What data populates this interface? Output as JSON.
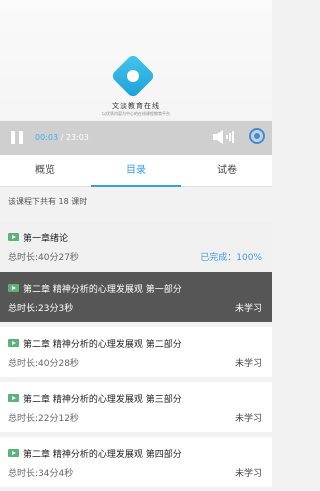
{
  "player": {
    "brand_name": "文淡教育在线",
    "brand_subtitle": "以优质内容为中心的在线课程教育平台",
    "time_current": "00:03",
    "time_separator": " / ",
    "time_total": "23:03",
    "icons": [
      "pause-icon",
      "volume-icon",
      "fullscreen-icon"
    ]
  },
  "tabs": [
    {
      "label": "概览"
    },
    {
      "label": "目录"
    },
    {
      "label": "试卷"
    }
  ],
  "active_tab": 1,
  "summary": "该课程下共有 18 课时",
  "lessons": [
    {
      "title": "第一章绪论",
      "duration": "总时长:40分27秒",
      "status": "已完成：100%"
    },
    {
      "title": "第二章 精神分析的心理发展观 第一部分",
      "duration": "总时长:23分3秒",
      "status": "未学习"
    },
    {
      "title": "第二章 精神分析的心理发展观 第二部分",
      "duration": "总时长:40分28秒",
      "status": "未学习"
    },
    {
      "title": "第二章 精神分析的心理发展观 第三部分",
      "duration": "总时长:22分12秒",
      "status": "未学习"
    },
    {
      "title": "第二章 精神分析的心理发展观 第四部分",
      "duration": "总时长:34分4秒",
      "status": "未学习"
    }
  ],
  "colors": {
    "accent": "#3a9be0",
    "current_row": "#565656",
    "video_icon": "#5cb27a"
  }
}
